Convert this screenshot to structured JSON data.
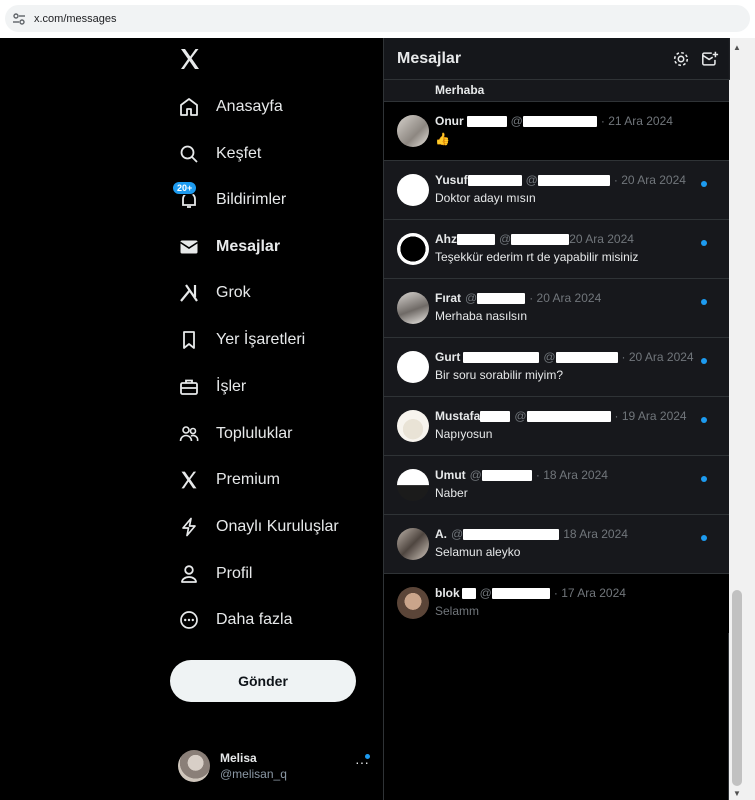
{
  "browser": {
    "url": "x.com/messages",
    "site_icon": "site-settings-icon"
  },
  "nav": {
    "logo": "x-logo-icon",
    "items": [
      {
        "label": "Anasayfa",
        "icon": "home-icon"
      },
      {
        "label": "Keşfet",
        "icon": "search-icon"
      },
      {
        "label": "Bildirimler",
        "icon": "bell-icon",
        "badge": "20+"
      },
      {
        "label": "Mesajlar",
        "icon": "envelope-icon",
        "active": true
      },
      {
        "label": "Grok",
        "icon": "grok-icon"
      },
      {
        "label": "Yer İşaretleri",
        "icon": "bookmark-icon"
      },
      {
        "label": "İşler",
        "icon": "briefcase-icon"
      },
      {
        "label": "Topluluklar",
        "icon": "communities-icon"
      },
      {
        "label": "Premium",
        "icon": "x-icon"
      },
      {
        "label": "Onaylı Kuruluşlar",
        "icon": "lightning-icon"
      },
      {
        "label": "Profil",
        "icon": "person-icon"
      },
      {
        "label": "Daha fazla",
        "icon": "more-circle-icon"
      }
    ],
    "post_button": "Gönder",
    "account": {
      "name": "Melisa",
      "handle": "@melisan_q",
      "more": "···"
    }
  },
  "messages": {
    "title": "Mesajlar",
    "settings_icon": "gear-icon",
    "new_message_icon": "new-message-icon",
    "conversations": [
      {
        "name": "",
        "handle": "",
        "date": "",
        "message": "Merhaba",
        "unread": false,
        "partial": true
      },
      {
        "name": "Onur",
        "handle": "@",
        "date": "· 21 Ara 2024",
        "message": "👍",
        "unread": false,
        "selected": true
      },
      {
        "name": "Yusuf",
        "handle": "@",
        "date": "· 20 Ara 2024",
        "message": "Doktor adayı mısın",
        "unread": true
      },
      {
        "name": "Ahz",
        "handle": "@",
        "date": "20 Ara 2024",
        "message": "Teşekkür ederim rt de yapabilir misiniz",
        "unread": true
      },
      {
        "name": "Fırat",
        "handle": "@",
        "date": "· 20 Ara 2024",
        "message": "Merhaba nasılsın",
        "unread": true
      },
      {
        "name": "Gurt",
        "handle": "@",
        "date": "· 20 Ara 2024",
        "message": "Bir soru sorabilir miyim?",
        "unread": true
      },
      {
        "name": "Mustafa",
        "handle": "@",
        "date": "· 19 Ara 2024",
        "message": "Napıyosun",
        "unread": true
      },
      {
        "name": "Umut",
        "handle": "@",
        "date": "· 18 Ara 2024",
        "message": "Naber",
        "unread": true
      },
      {
        "name": "A.",
        "handle": "@",
        "date": "18 Ara 2024",
        "message": "Selamun aleyko",
        "unread": true
      },
      {
        "name": "blok",
        "handle": "@",
        "date": "· 17 Ara 2024",
        "message": "Selamm",
        "unread": false,
        "read": true
      }
    ]
  }
}
